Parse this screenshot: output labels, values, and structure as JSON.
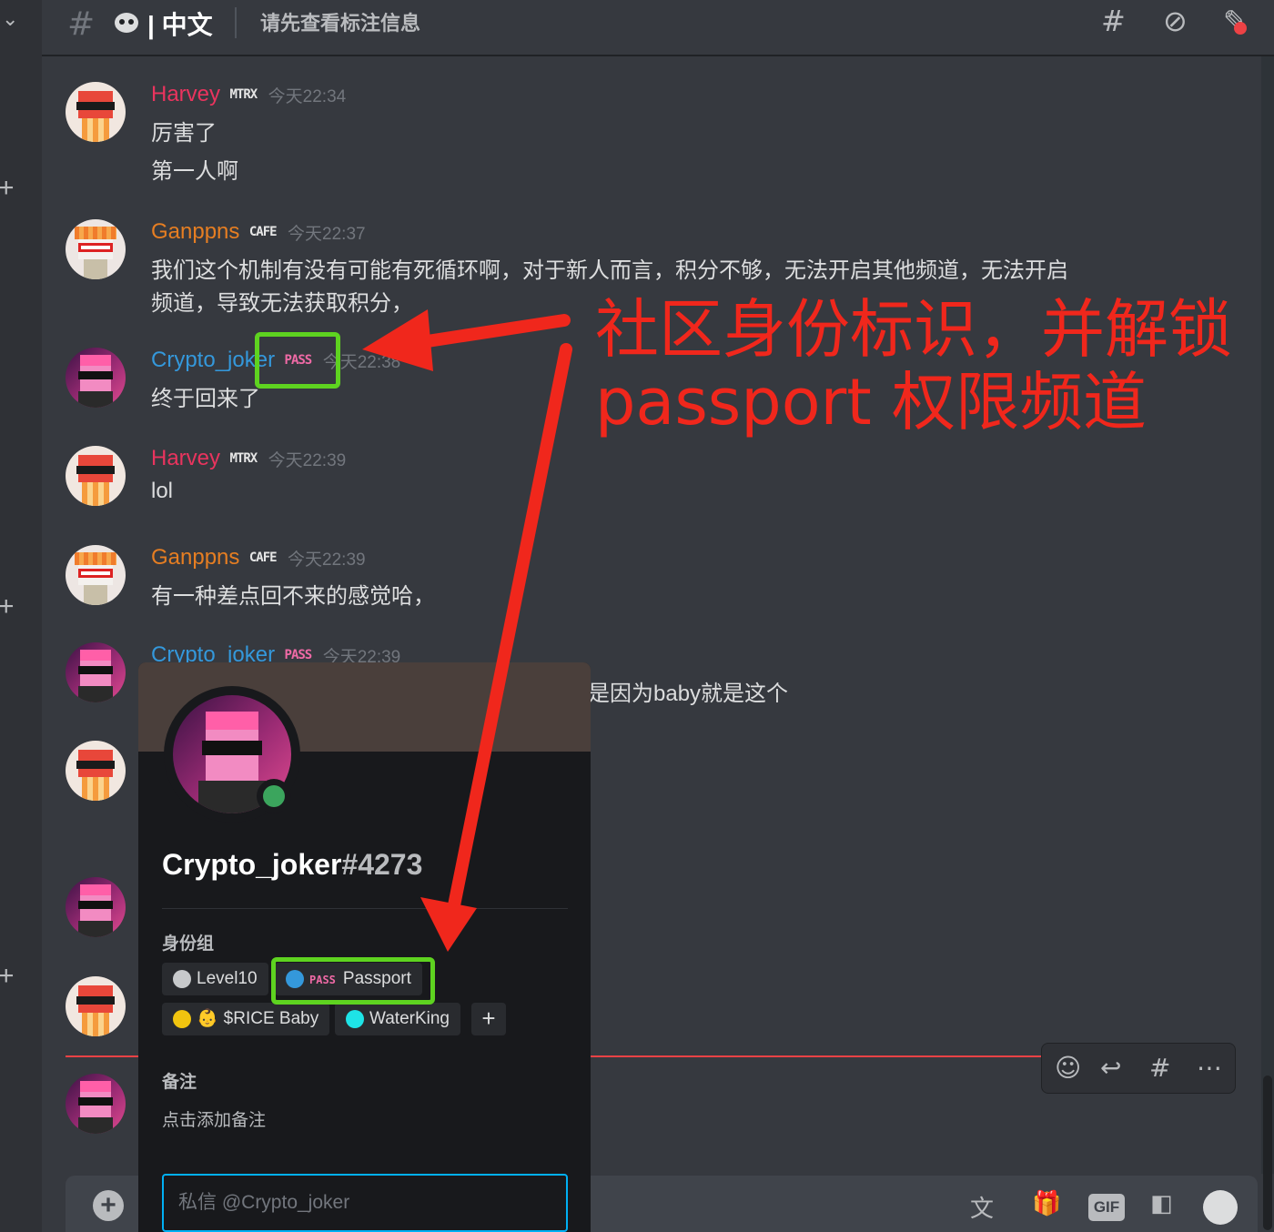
{
  "channel": {
    "name": "| 中文",
    "topic": "请先查看标注信息"
  },
  "messages": [
    {
      "user": "Harvey",
      "badge": "MTRX",
      "time": "今天22:34",
      "lines": [
        "厉害了",
        "第一人啊"
      ]
    },
    {
      "user": "Ganppns",
      "badge": "CAFE",
      "time": "今天22:37",
      "lines": [
        "我们这个机制有没有可能有死循环啊，对于新人而言，积分不够，无法开启其他频道，无法开启",
        "频道，导致无法获取积分，"
      ]
    },
    {
      "user": "Crypto_joker",
      "badge": "PASS",
      "time": "今天22:38",
      "lines": [
        "终于回来了"
      ]
    },
    {
      "user": "Harvey",
      "badge": "MTRX",
      "time": "今天22:39",
      "lines": [
        "lol"
      ]
    },
    {
      "user": "Ganppns",
      "badge": "CAFE",
      "time": "今天22:39",
      "lines": [
        "有一种差点回不来的感觉哈，"
      ]
    },
    {
      "user": "Crypto_joker",
      "badge": "PASS",
      "time": "今天22:39",
      "lines": [
        "是因为baby就是这个"
      ]
    }
  ],
  "profile": {
    "username": "Crypto_joker",
    "discriminator": "#4273",
    "roles_title": "身份组",
    "roles": [
      {
        "name": "Level10",
        "color": "#c7c9cb",
        "badge": ""
      },
      {
        "name": "Passport",
        "color": "#3498db",
        "badge": "PASS"
      },
      {
        "name": "$RICE Baby",
        "color": "#f1c40f",
        "badge": "👶"
      },
      {
        "name": "WaterKing",
        "color": "#1ee3e6",
        "badge": ""
      }
    ],
    "add_role": "+",
    "note_title": "备注",
    "note_placeholder": "点击添加备注",
    "dm_placeholder": "私信 @Crypto_joker"
  },
  "annotation": {
    "line1": "社区身份标识，并解锁",
    "line2": "passport 权限频道"
  },
  "composer": {
    "gif_label": "GIF"
  },
  "icons": {
    "header": [
      "threads-icon",
      "mute-icon",
      "pin-icon"
    ],
    "hover": [
      "add-reaction-icon",
      "reply-icon",
      "thread-icon",
      "more-icon"
    ],
    "composer": [
      "translate-icon",
      "gift-icon",
      "gif-icon",
      "sticker-icon",
      "emoji-icon"
    ]
  },
  "colors": {
    "harvey": "#e9345e",
    "ganppns": "#e67e22",
    "crypto_joker": "#3498db",
    "annotation": "#f0271c",
    "highlight": "#5ed320"
  }
}
